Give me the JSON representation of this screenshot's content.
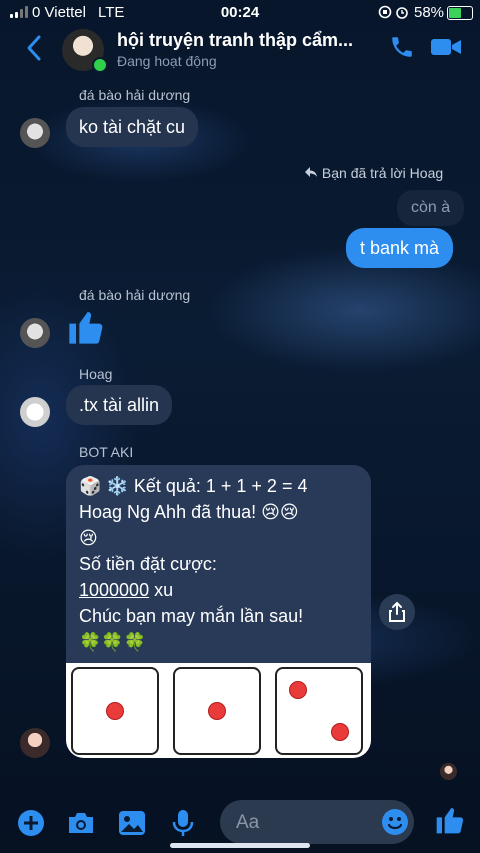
{
  "status_bar": {
    "carrier": "0 Viettel",
    "network": "LTE",
    "time": "00:24",
    "battery": "58%",
    "battery_level": 0.58
  },
  "header": {
    "title": "hội truyện tranh thập cẩm...",
    "subtitle": "Đang hoạt động"
  },
  "messages": {
    "m1": {
      "sender": "đá bào hải dương",
      "text": "ko tài chặt cu"
    },
    "m2": {
      "reply_label": "Bạn đã trả lời Hoag",
      "quoted": "còn à",
      "text": "t bank mà"
    },
    "m3": {
      "sender": "đá bào hải dương",
      "sticker": "thumbs-up"
    },
    "m4": {
      "sender": "Hoag",
      "text": ".tx tài allin"
    },
    "bot": {
      "sender": "BOT AKI",
      "line1": "🎲 ❄️ Kết quả: 1 + 1 + 2 = 4",
      "line2": "Hoag Ng Ahh đã thua! 😢😢",
      "line3": "😢",
      "line4": "Số tiền đặt cược:",
      "amount": "1000000",
      "unit": " xu",
      "line6": "Chúc bạn may mắn lần sau!",
      "line7": "🍀🍀🍀",
      "dice": [
        1,
        1,
        2
      ]
    }
  },
  "composer": {
    "placeholder": "Aa"
  },
  "colors": {
    "accent": "#2e8ef0",
    "incoming_bubble": "#253550",
    "online": "#2fd04a",
    "pip": "#ea3b3b"
  }
}
